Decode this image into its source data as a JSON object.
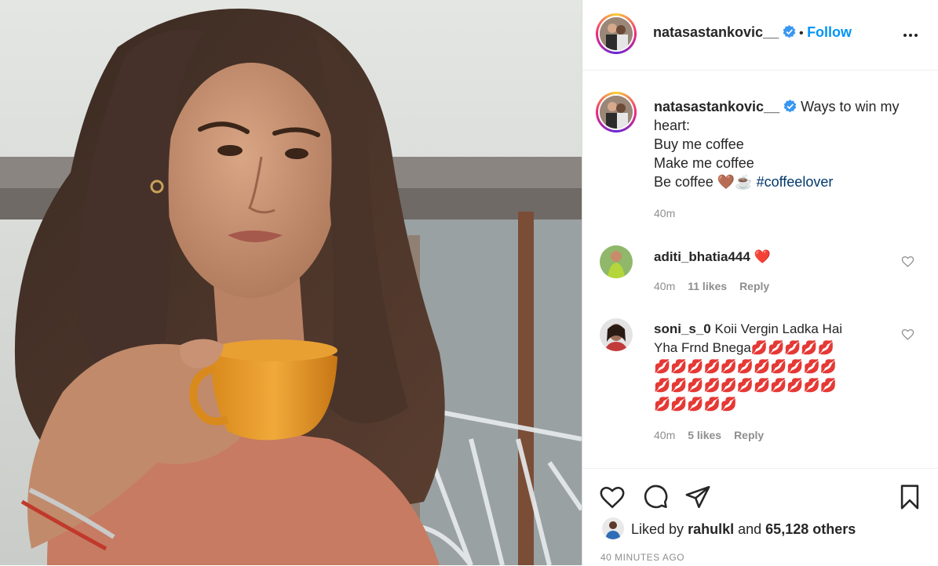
{
  "post": {
    "username": "natasastankovic__",
    "separator": "•",
    "follow_label": "Follow",
    "caption_lines": [
      "Ways to win my",
      "heart:",
      "Buy me coffee",
      "Make me coffee",
      "Be coffee"
    ],
    "caption_emoji": "🤎☕",
    "hashtag": "#coffeelover",
    "caption_time": "40m"
  },
  "comments": [
    {
      "username": "aditi_bhatia444",
      "text": "❤️",
      "time": "40m",
      "likes": "11 likes",
      "reply": "Reply"
    },
    {
      "username": "soni_s_0",
      "text_line1": "Koii Vergin Ladka Hai",
      "text_line2": "Yha Frnd Bnega",
      "lips_row1": "💋💋💋💋💋",
      "lips_row2": "💋💋💋💋💋💋💋💋💋💋💋",
      "lips_row3": "💋💋💋💋💋💋💋💋💋💋💋",
      "lips_row4": "💋💋💋💋💋",
      "time": "40m",
      "likes": "5 likes",
      "reply": "Reply"
    }
  ],
  "likes": {
    "prefix": "Liked by",
    "user": "rahulkl",
    "joiner": "and",
    "others": "65,128 others"
  },
  "timestamp": "40 MINUTES AGO",
  "colors": {
    "accent": "#0095f6",
    "verified": "#3897f0",
    "hashtag": "#00376b",
    "muted": "#8e8e8e"
  }
}
